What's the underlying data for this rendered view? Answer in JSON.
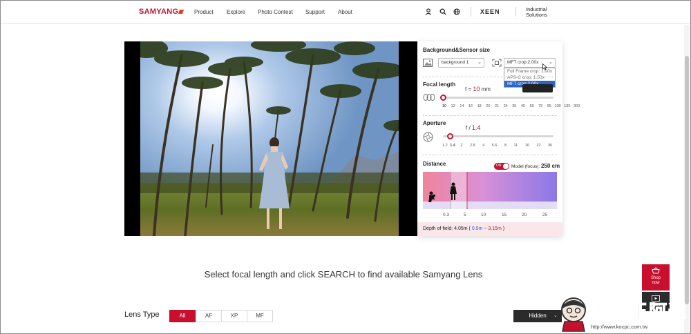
{
  "header": {
    "logo": "SAMYANG",
    "nav": [
      "Product",
      "Explore",
      "Photo Contest",
      "Support",
      "About"
    ],
    "xeen": "XEEN",
    "industrial_line1": "Industrial",
    "industrial_line2": "Solutions"
  },
  "panel": {
    "background_sensor": {
      "title": "Background&Sensor size",
      "background_value": "background 1",
      "sensor_value": "MFT crop:2.00x",
      "sensor_options": [
        "Full Frame crop: 1.00x",
        "APS-C crop: 1.50x",
        "MFT crop:2.00x"
      ],
      "selected_option": "MFT crop:2.00x"
    },
    "focal_length": {
      "title": "Focal length",
      "prefix": "f = ",
      "value": "10",
      "unit": " mm",
      "ticks": [
        "10",
        "12",
        "14",
        "16",
        "18",
        "20",
        "21",
        "24",
        "35",
        "45",
        "50",
        "75",
        "85",
        "100",
        "135",
        "300"
      ],
      "level": 0.0
    },
    "aperture": {
      "title": "Aperture",
      "prefix": "f / ",
      "value": "1.4",
      "ticks": [
        "1.2",
        "1.4",
        "2",
        "2.8",
        "4",
        "5.6",
        "8",
        "11",
        "16",
        "22",
        "36"
      ],
      "level": 0.06
    },
    "distance": {
      "title": "Distance",
      "toggle_text": "ON",
      "model_label": "Model (focus): ",
      "model_value": "250 cm",
      "ticks": [
        "0.3",
        "5",
        "10",
        "15",
        "20",
        "25"
      ]
    },
    "dof": {
      "label": "Depth of field: ",
      "value": "4.05m",
      "open": " ( ",
      "near": "0.9m",
      "sep": " ~ ",
      "far": "3.15m",
      "close": " )"
    }
  },
  "instruction": "Select focal length and click SEARCH to find available Samyang Lens",
  "lens_type": {
    "label": "Lens Type",
    "tabs": [
      "All",
      "AF",
      "XP",
      "MF"
    ],
    "active": "All",
    "hidden_label": "Hidden"
  },
  "floating": {
    "shop_line1": "Shop",
    "shop_line2": "now",
    "tube_label": "Tube"
  },
  "watermark": {
    "title": "電腦王阿達",
    "url": "http://www.kocpc.com.tw"
  },
  "colors": {
    "brand_red": "#c8102e",
    "dark_button": "#2b2b2b",
    "selection_blue": "#2a66c8"
  }
}
